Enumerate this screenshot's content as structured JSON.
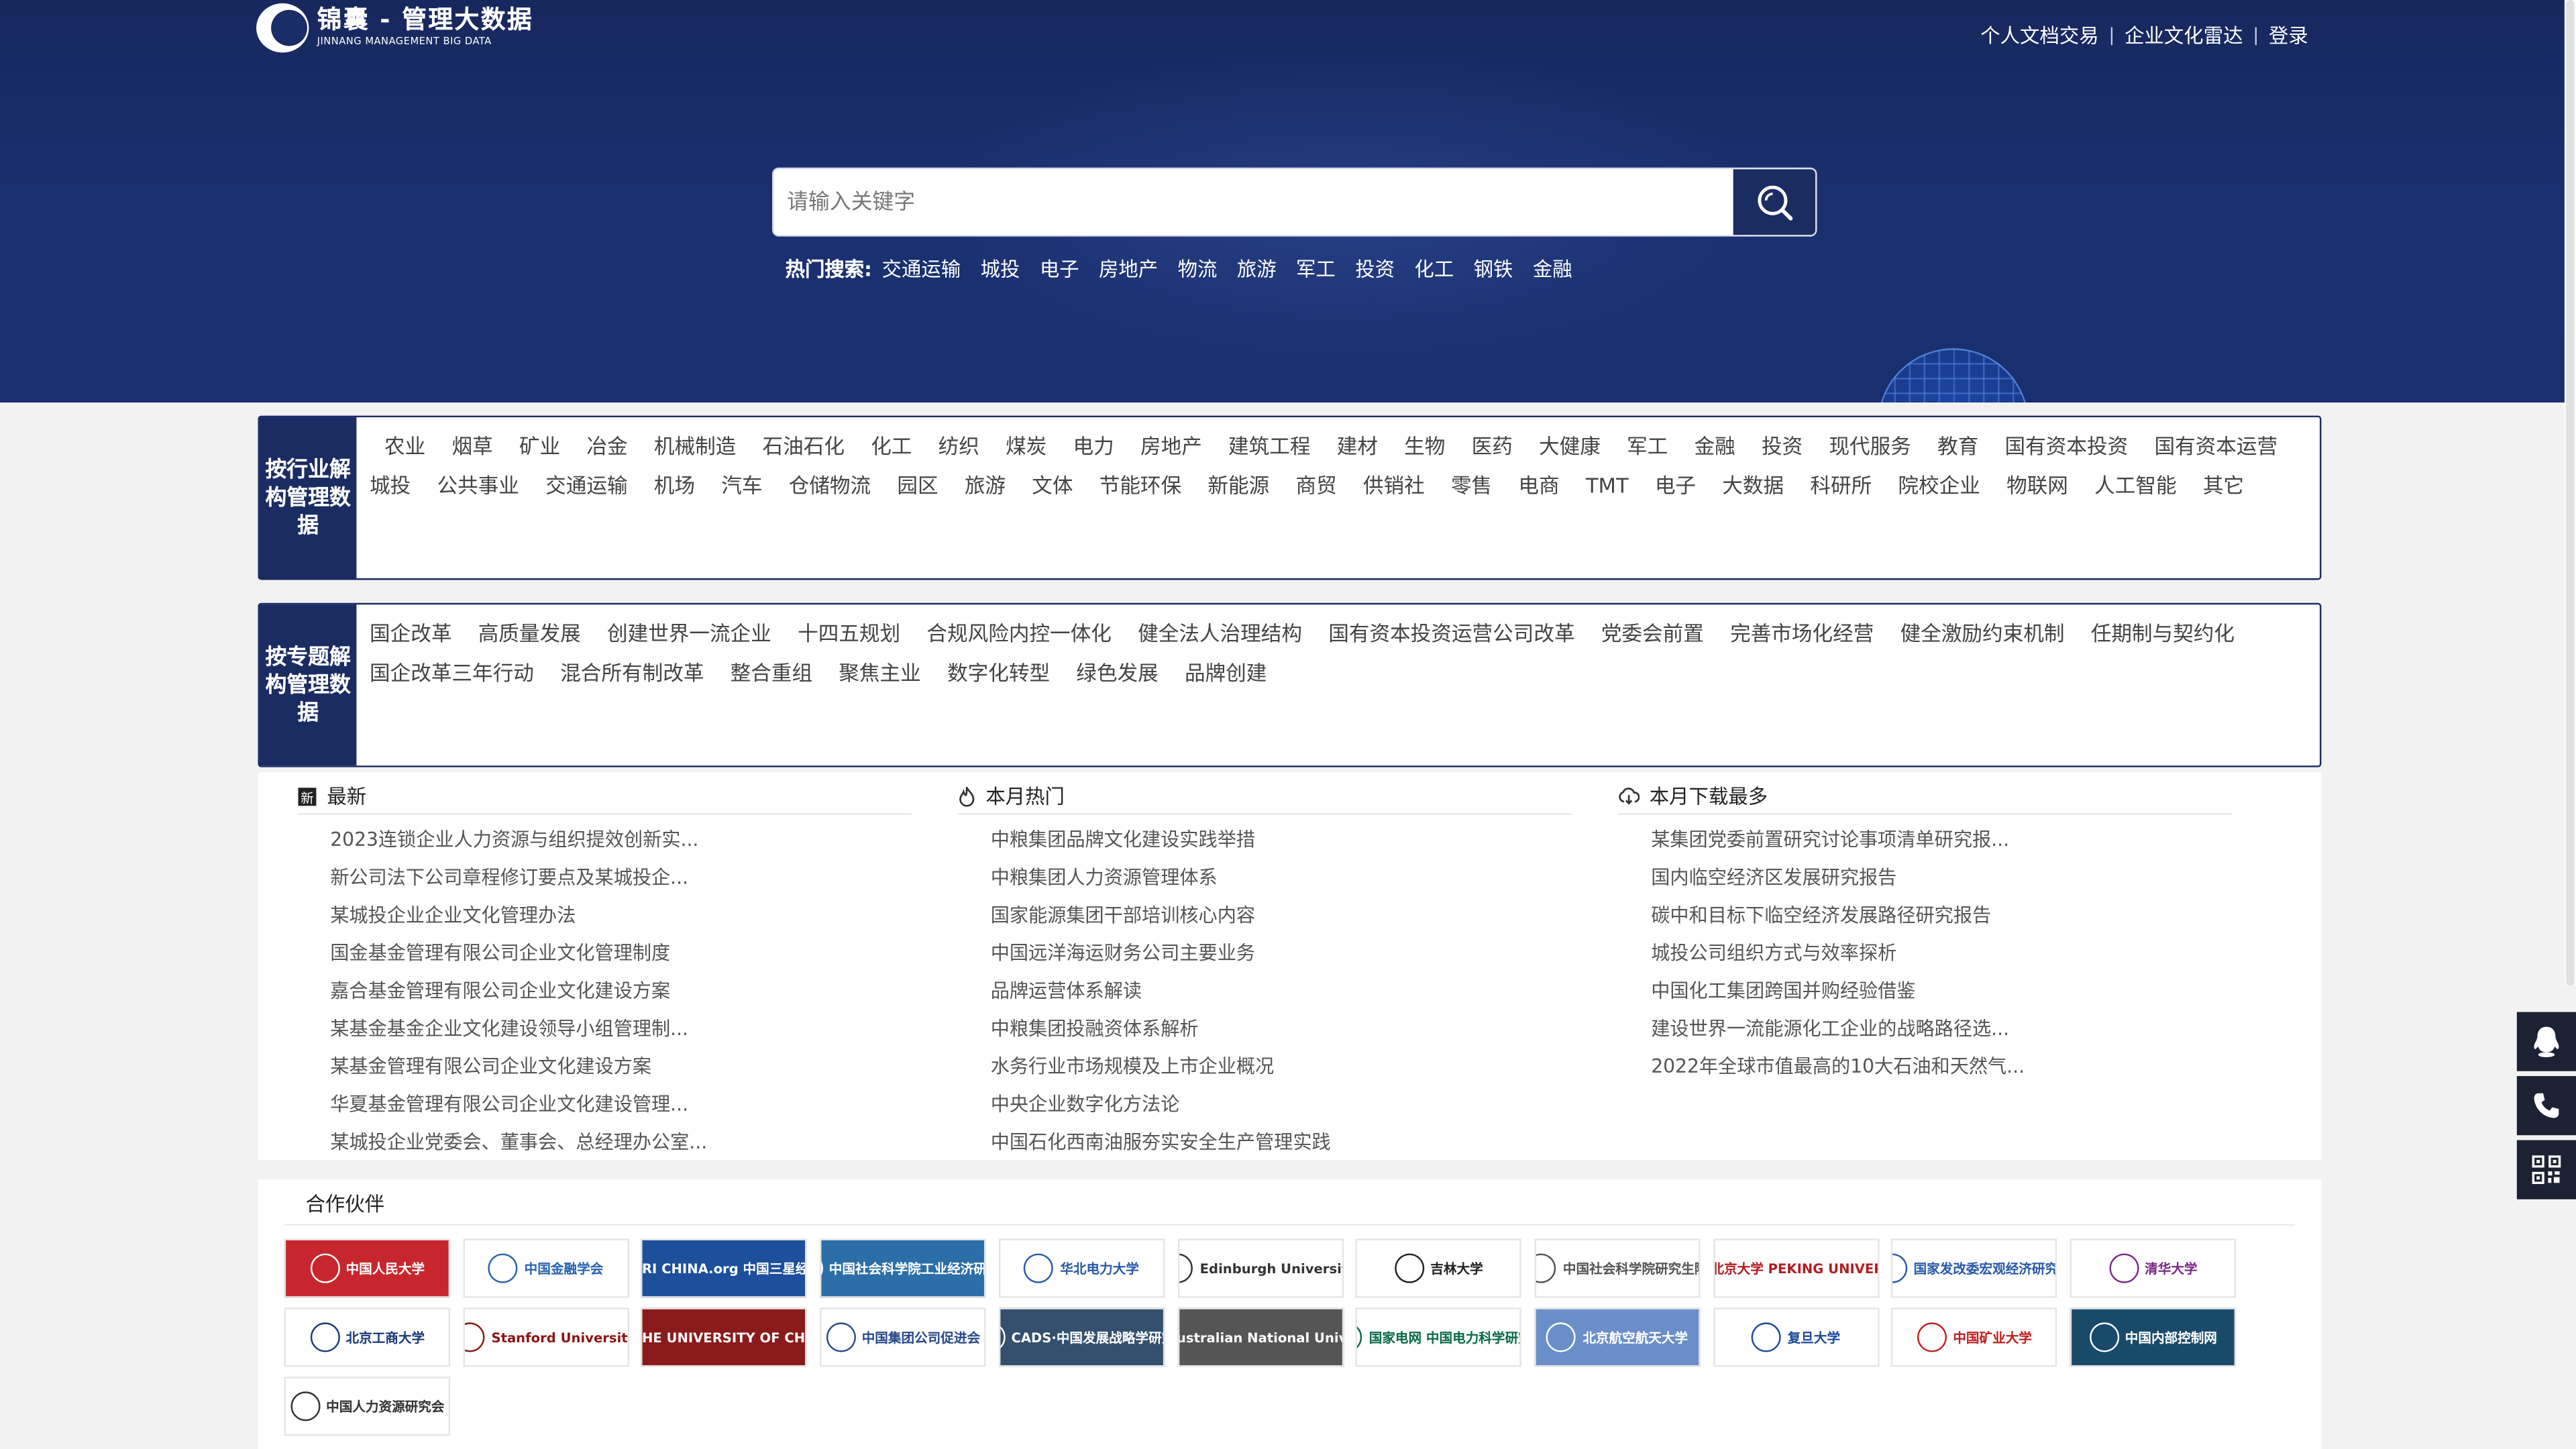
{
  "logo": {
    "cn": "锦囊 - 管理大数据",
    "en": "JINNANG  MANAGEMENT BIG DATA"
  },
  "topnav": {
    "items": [
      "个人文档交易",
      "企业文化雷达",
      "登录"
    ],
    "separator": "|"
  },
  "search": {
    "placeholder": "请输入关键字",
    "icon": "search-icon"
  },
  "hot_search": {
    "label": "热门搜索:",
    "keywords": [
      "交通运输",
      "城投",
      "电子",
      "房地产",
      "物流",
      "旅游",
      "军工",
      "投资",
      "化工",
      "钢铁",
      "金融"
    ]
  },
  "industry_panel": {
    "title": "按行业解构管理数据",
    "row1": [
      "农业",
      "烟草",
      "矿业",
      "冶金",
      "机械制造",
      "石油石化",
      "化工",
      "纺织",
      "煤炭",
      "电力",
      "房地产",
      "建筑工程",
      "建材",
      "生物",
      "医药",
      "大健康",
      "军工",
      "金融",
      "投资",
      "现代服务",
      "教育",
      "国有资本投资",
      "国有资本运营"
    ],
    "row2": [
      "城投",
      "公共事业",
      "交通运输",
      "机场",
      "汽车",
      "仓储物流",
      "园区",
      "旅游",
      "文体",
      "节能环保",
      "新能源",
      "商贸",
      "供销社",
      "零售",
      "电商",
      "TMT",
      "电子",
      "大数据",
      "科研所",
      "院校企业",
      "物联网",
      "人工智能",
      "其它"
    ]
  },
  "topic_panel": {
    "title": "按专题解构管理数据",
    "row1": [
      "国企改革",
      "高质量发展",
      "创建世界一流企业",
      "十四五规划",
      "合规风险内控一体化",
      "健全法人治理结构",
      "国有资本投资运营公司改革",
      "党委会前置",
      "完善市场化经营",
      "健全激励约束机制",
      "任期制与契约化"
    ],
    "row2": [
      "国企改革三年行动",
      "混合所有制改革",
      "整合重组",
      "聚焦主业",
      "数字化转型",
      "绿色发展",
      "品牌创建"
    ]
  },
  "lists": {
    "latest": {
      "title": "最新",
      "items": [
        "2023连锁企业人力资源与组织提效创新实...",
        "新公司法下公司章程修订要点及某城投企...",
        "某城投企业企业文化管理办法",
        "国金基金管理有限公司企业文化管理制度",
        "嘉合基金管理有限公司企业文化建设方案",
        "某基金基金企业文化建设领导小组管理制...",
        "某基金管理有限公司企业文化建设方案",
        "华夏基金管理有限公司企业文化建设管理...",
        "某城投企业党委会、董事会、总经理办公室..."
      ]
    },
    "monthly_hot": {
      "title": "本月热门",
      "items": [
        "中粮集团品牌文化建设实践举措",
        "中粮集团人力资源管理体系",
        "国家能源集团干部培训核心内容",
        "中国远洋海运财务公司主要业务",
        "品牌运营体系解读",
        "中粮集团投融资体系解析",
        "水务行业市场规模及上市企业概况",
        "中央企业数字化方法论",
        "中国石化西南油服夯实安全生产管理实践"
      ]
    },
    "monthly_download": {
      "title": "本月下载最多",
      "items": [
        "某集团党委前置研究讨论事项清单研究报...",
        "国内临空经济区发展研究报告",
        "碳中和目标下临空经济发展路径研究报告",
        "城投公司组织方式与效率探析",
        "中国化工集团跨国并购经验借鉴",
        "建设世界一流能源化工企业的战略路径选...",
        "2022年全球市值最高的10大石油和天然气..."
      ]
    }
  },
  "partners": {
    "title": "合作伙伴",
    "logos": [
      {
        "text": "中国人民大学",
        "bg": "#c8262e",
        "fg": "#ffffff"
      },
      {
        "text": "中国金融学会",
        "bg": "#ffffff",
        "fg": "#2a64b0"
      },
      {
        "text": "SERI CHINA.org 中国三星经济研究院",
        "bg": "#1d4f9c",
        "fg": "#ffffff"
      },
      {
        "text": "中国社会科学院工业经济研究所",
        "bg": "#2b6ea8",
        "fg": "#ffffff"
      },
      {
        "text": "华北电力大学",
        "bg": "#ffffff",
        "fg": "#2a5aa8"
      },
      {
        "text": "Edinburgh University",
        "bg": "#ffffff",
        "fg": "#333333"
      },
      {
        "text": "吉林大学",
        "bg": "#ffffff",
        "fg": "#222222"
      },
      {
        "text": "中国社会科学院研究生院",
        "bg": "#ffffff",
        "fg": "#555555"
      },
      {
        "text": "北京大学 PEKING UNIVERSITY",
        "bg": "#ffffff",
        "fg": "#b01e23"
      },
      {
        "text": "国家发改委宏观经济研究院",
        "bg": "#ffffff",
        "fg": "#2a5aa8"
      },
      {
        "text": "清华大学",
        "bg": "#ffffff",
        "fg": "#7a2a8a"
      },
      {
        "text": "北京工商大学",
        "bg": "#ffffff",
        "fg": "#1a3a7a"
      },
      {
        "text": "Stanford University",
        "bg": "#ffffff",
        "fg": "#8c1515"
      },
      {
        "text": "THE UNIVERSITY OF CHICAGO",
        "bg": "#8b1a1a",
        "fg": "#ffffff"
      },
      {
        "text": "中国集团公司促进会",
        "bg": "#ffffff",
        "fg": "#2a4a8a"
      },
      {
        "text": "CADS·中国发展战略学研究会",
        "bg": "#34506e",
        "fg": "#ffffff"
      },
      {
        "text": "Australian National University",
        "bg": "#555555",
        "fg": "#ffffff"
      },
      {
        "text": "国家电网 中国电力科学研究院",
        "bg": "#ffffff",
        "fg": "#0a6a4a"
      },
      {
        "text": "北京航空航天大学",
        "bg": "#6a8ec8",
        "fg": "#ffffff"
      },
      {
        "text": "复旦大学",
        "bg": "#ffffff",
        "fg": "#1a4a9a"
      },
      {
        "text": "中国矿业大学",
        "bg": "#ffffff",
        "fg": "#c02020"
      },
      {
        "text": "中国内部控制网",
        "bg": "#1a4a6a",
        "fg": "#ffffff"
      },
      {
        "text": "中国人力资源研究会",
        "bg": "#ffffff",
        "fg": "#333333"
      }
    ]
  },
  "floating": {
    "buttons": [
      "qq-icon",
      "phone-icon",
      "qrcode-icon"
    ]
  }
}
